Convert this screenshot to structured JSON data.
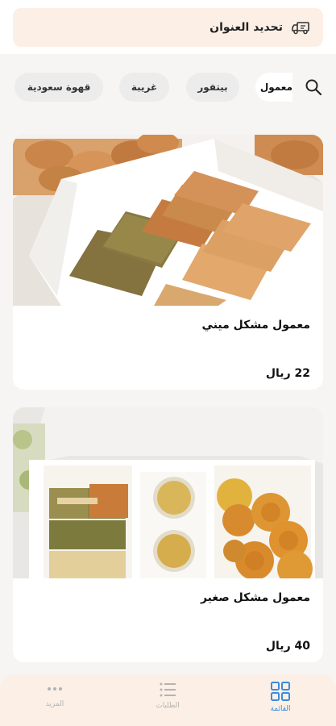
{
  "header": {
    "address_label": "تحديد العنوان",
    "truck_icon": "delivery-truck-icon"
  },
  "categories": {
    "search_icon": "search-icon",
    "items": [
      {
        "label": "معمول",
        "active": true
      },
      {
        "label": "بيتفور",
        "active": false
      },
      {
        "label": "غريبة",
        "active": false
      },
      {
        "label": "قهوة سعودية",
        "active": false
      }
    ]
  },
  "products": [
    {
      "name": "معمول مشكل ميني",
      "price": "22 ريال"
    },
    {
      "name": "معمول مشكل صغير",
      "price": "40 ريال"
    }
  ],
  "bottom_nav": {
    "items": [
      {
        "label": "القائمة",
        "icon": "grid-icon",
        "active": true
      },
      {
        "label": "الطلبات",
        "icon": "list-icon",
        "active": false
      },
      {
        "label": "المزيد",
        "icon": "more-dots-icon",
        "active": false
      }
    ]
  },
  "colors": {
    "accent": "#3a8ce0",
    "header_bg": "#fcefe6",
    "nav_bg": "#fcefe6",
    "inactive": "#b3b3b3"
  }
}
